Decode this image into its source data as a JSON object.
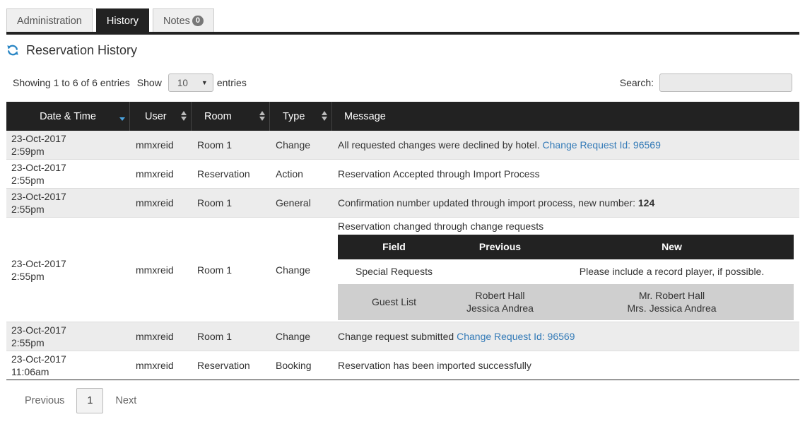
{
  "tabs": [
    {
      "label": "Administration"
    },
    {
      "label": "History"
    },
    {
      "label": "Notes",
      "badge": "0"
    }
  ],
  "section": {
    "title": "Reservation History"
  },
  "controls": {
    "showing": "Showing 1 to 6 of 6 entries",
    "show_label": "Show",
    "page_size": "10",
    "entries_label": "entries",
    "search_label": "Search:",
    "search_value": ""
  },
  "columns": [
    "Date & Time",
    "User",
    "Room",
    "Type",
    "Message"
  ],
  "rows": [
    {
      "date": "23-Oct-2017",
      "time": "2:59pm",
      "user": "mmxreid",
      "room": "Room 1",
      "type": "Change",
      "message": "All requested changes were declined by hotel. ",
      "link": "Change Request Id: 96569"
    },
    {
      "date": "23-Oct-2017",
      "time": "2:55pm",
      "user": "mmxreid",
      "room": "Reservation",
      "type": "Action",
      "message": "Reservation Accepted through Import Process"
    },
    {
      "date": "23-Oct-2017",
      "time": "2:55pm",
      "user": "mmxreid",
      "room": "Room 1",
      "type": "General",
      "message": "Confirmation number updated through import process, new number: ",
      "bold": "124"
    },
    {
      "date": "23-Oct-2017",
      "time": "2:55pm",
      "user": "mmxreid",
      "room": "Room 1",
      "type": "Change",
      "message": "Reservation changed through change requests",
      "changes": {
        "headers": [
          "Field",
          "Previous",
          "New"
        ],
        "items": [
          {
            "field": "Special Requests",
            "previous": "",
            "previous2": "",
            "new": "Please include a record player, if possible.",
            "new2": ""
          },
          {
            "field": "Guest List",
            "previous": "Robert Hall",
            "previous2": "Jessica Andrea",
            "new": "Mr. Robert Hall",
            "new2": "Mrs. Jessica Andrea"
          }
        ]
      }
    },
    {
      "date": "23-Oct-2017",
      "time": "2:55pm",
      "user": "mmxreid",
      "room": "Room 1",
      "type": "Change",
      "message": "Change request submitted ",
      "link": "Change Request Id: 96569"
    },
    {
      "date": "23-Oct-2017",
      "time": "11:06am",
      "user": "mmxreid",
      "room": "Reservation",
      "type": "Booking",
      "message": "Reservation has been imported successfully"
    }
  ],
  "pagination": {
    "previous": "Previous",
    "current": "1",
    "next": "Next"
  },
  "colors": {
    "header_bg": "#222222",
    "link": "#337ab7",
    "stripe": "#ececec",
    "nested_stripe": "#cfcfcf"
  }
}
